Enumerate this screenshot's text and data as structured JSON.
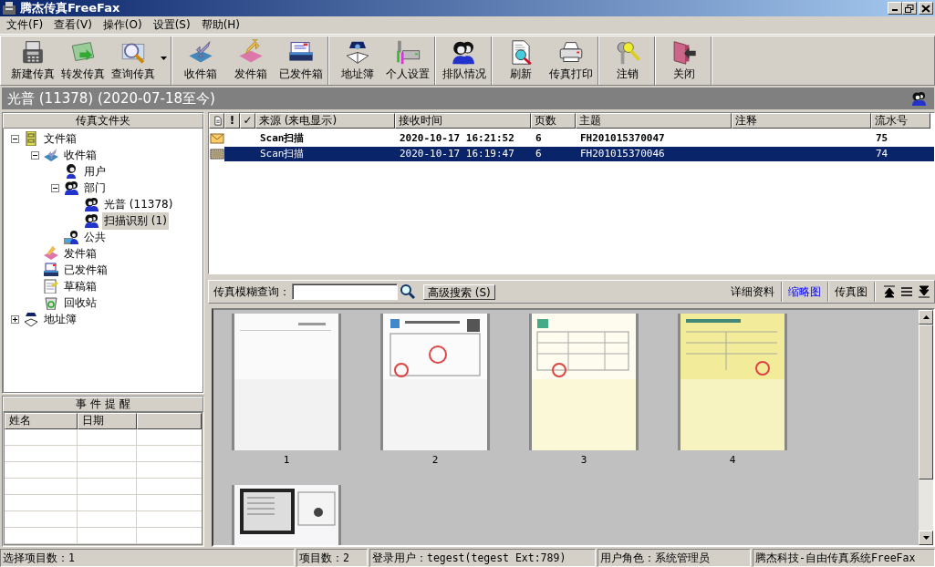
{
  "window": {
    "title": "腾杰传真FreeFax"
  },
  "menu": [
    "文件(F)",
    "查看(V)",
    "操作(O)",
    "设置(S)",
    "帮助(H)"
  ],
  "toolbar": [
    [
      {
        "label": "新建传真",
        "has_menu": false
      },
      {
        "label": "转发传真",
        "has_menu": false
      },
      {
        "label": "查询传真",
        "has_menu": true
      }
    ],
    [
      {
        "label": "收件箱",
        "has_menu": false
      },
      {
        "label": "发件箱",
        "has_menu": false
      },
      {
        "label": "已发件箱",
        "has_menu": false
      }
    ],
    [
      {
        "label": "地址簿",
        "has_menu": false
      },
      {
        "label": "个人设置",
        "has_menu": false
      }
    ],
    [
      {
        "label": "排队情况",
        "has_menu": false
      }
    ],
    [
      {
        "label": "刷新",
        "has_menu": false
      },
      {
        "label": "传真打印",
        "has_menu": false
      }
    ],
    [
      {
        "label": "注销",
        "has_menu": false
      }
    ],
    [
      {
        "label": "关闭",
        "has_menu": false
      }
    ]
  ],
  "banner": {
    "title": "光普 (11378) (2020-07-18至今)"
  },
  "folders": {
    "title": "传真文件夹",
    "tree": [
      {
        "label": "文件箱",
        "selected": false,
        "expanded": true,
        "children": [
          {
            "label": "收件箱",
            "selected": false,
            "expanded": true,
            "children": [
              {
                "label": "用户",
                "selected": false
              },
              {
                "label": "部门",
                "selected": false,
                "expanded": true,
                "children": [
                  {
                    "label": "光普 (11378)",
                    "selected": false
                  },
                  {
                    "label": "扫描识别 (1)",
                    "selected": true
                  }
                ]
              },
              {
                "label": "公共",
                "selected": false
              }
            ]
          },
          {
            "label": "发件箱",
            "selected": false
          },
          {
            "label": "已发件箱",
            "selected": false
          },
          {
            "label": "草稿箱",
            "selected": false
          },
          {
            "label": "回收站",
            "selected": false
          }
        ]
      },
      {
        "label": "地址簿",
        "selected": false,
        "expanded": false
      }
    ]
  },
  "events": {
    "title": "事 件 提 醒",
    "columns": [
      "姓名",
      "日期"
    ]
  },
  "messages": {
    "flag_columns": [
      "!",
      "✓"
    ],
    "columns": [
      "来源 (来电显示)",
      "接收时间",
      "页数",
      "主题",
      "注释",
      "流水号"
    ],
    "rows": [
      {
        "unread": true,
        "selected": false,
        "cells": [
          "Scan扫描",
          "2020-10-17 16:21:52",
          "6",
          "FH201015370047",
          "",
          "75"
        ]
      },
      {
        "unread": false,
        "selected": true,
        "cells": [
          "Scan扫描",
          "2020-10-17 16:19:47",
          "6",
          "FH201015370046",
          "",
          "74"
        ]
      }
    ]
  },
  "search": {
    "label": "传真模糊查询：",
    "button": "高级搜索 (S)"
  },
  "views": [
    {
      "label": "详细资料",
      "selected": false
    },
    {
      "label": "缩略图",
      "selected": true
    },
    {
      "label": "传真图",
      "selected": false
    }
  ],
  "thumbnails": [
    {
      "kind": "picture",
      "caption": "1"
    },
    {
      "kind": "picture",
      "caption": "2"
    },
    {
      "kind": "picture",
      "caption": "3"
    },
    {
      "kind": "picture",
      "caption": "4"
    },
    {
      "kind": "picture"
    }
  ],
  "status_bar": [
    "选择项目数：1",
    "项目数：2",
    "登录用户：tegest(tegest Ext:789)",
    "用户角色：系统管理员",
    "腾杰科技-自由传真系统FreeFax"
  ]
}
